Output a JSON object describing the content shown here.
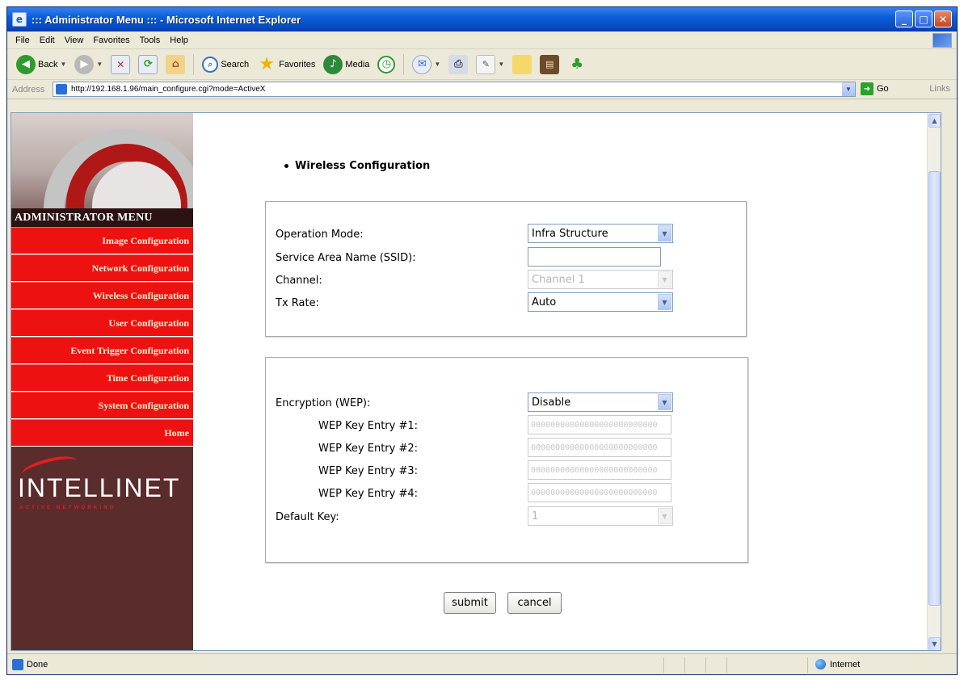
{
  "window": {
    "title": "::: Administrator Menu ::: - Microsoft Internet Explorer"
  },
  "menubar": {
    "items": [
      "File",
      "Edit",
      "View",
      "Favorites",
      "Tools",
      "Help"
    ]
  },
  "toolbar": {
    "back_label": "Back",
    "search_label": "Search",
    "favorites_label": "Favorites",
    "media_label": "Media"
  },
  "addressbar": {
    "label": "Address",
    "url": "http://192.168.1.96/main_configure.cgi?mode=ActiveX",
    "go_label": "Go",
    "links_label": "Links"
  },
  "sidebar": {
    "title": "ADMINISTRATOR MENU",
    "items": [
      {
        "label": "Image Configuration"
      },
      {
        "label": "Network Configuration"
      },
      {
        "label": "Wireless Configuration"
      },
      {
        "label": "User Configuration"
      },
      {
        "label": "Event Trigger Configuration"
      },
      {
        "label": "Time Configuration"
      },
      {
        "label": "System Configuration"
      },
      {
        "label": "Home"
      }
    ],
    "logo_text": "INTELLINET",
    "logo_sub": "ACTIVE NETWORKING"
  },
  "main": {
    "section_title": "Wireless Configuration",
    "panel1": {
      "operation_mode_label": "Operation Mode:",
      "operation_mode_value": "Infra Structure",
      "ssid_label": "Service Area Name (SSID):",
      "ssid_value": "",
      "channel_label": "Channel:",
      "channel_value": "Channel 1",
      "tx_rate_label": "Tx Rate:",
      "tx_rate_value": "Auto"
    },
    "panel2": {
      "encryption_label": "Encryption (WEP):",
      "encryption_value": "Disable",
      "wep_keys": [
        {
          "label": "WEP Key Entry #1:",
          "value": "00000000000000000000000000"
        },
        {
          "label": "WEP Key Entry #2:",
          "value": "00000000000000000000000000"
        },
        {
          "label": "WEP Key Entry #3:",
          "value": "00000000000000000000000000"
        },
        {
          "label": "WEP Key Entry #4:",
          "value": "00000000000000000000000000"
        }
      ],
      "default_key_label": "Default Key:",
      "default_key_value": "1"
    },
    "submit_label": "submit",
    "cancel_label": "cancel"
  },
  "statusbar": {
    "status_text": "Done",
    "zone_text": "Internet"
  }
}
